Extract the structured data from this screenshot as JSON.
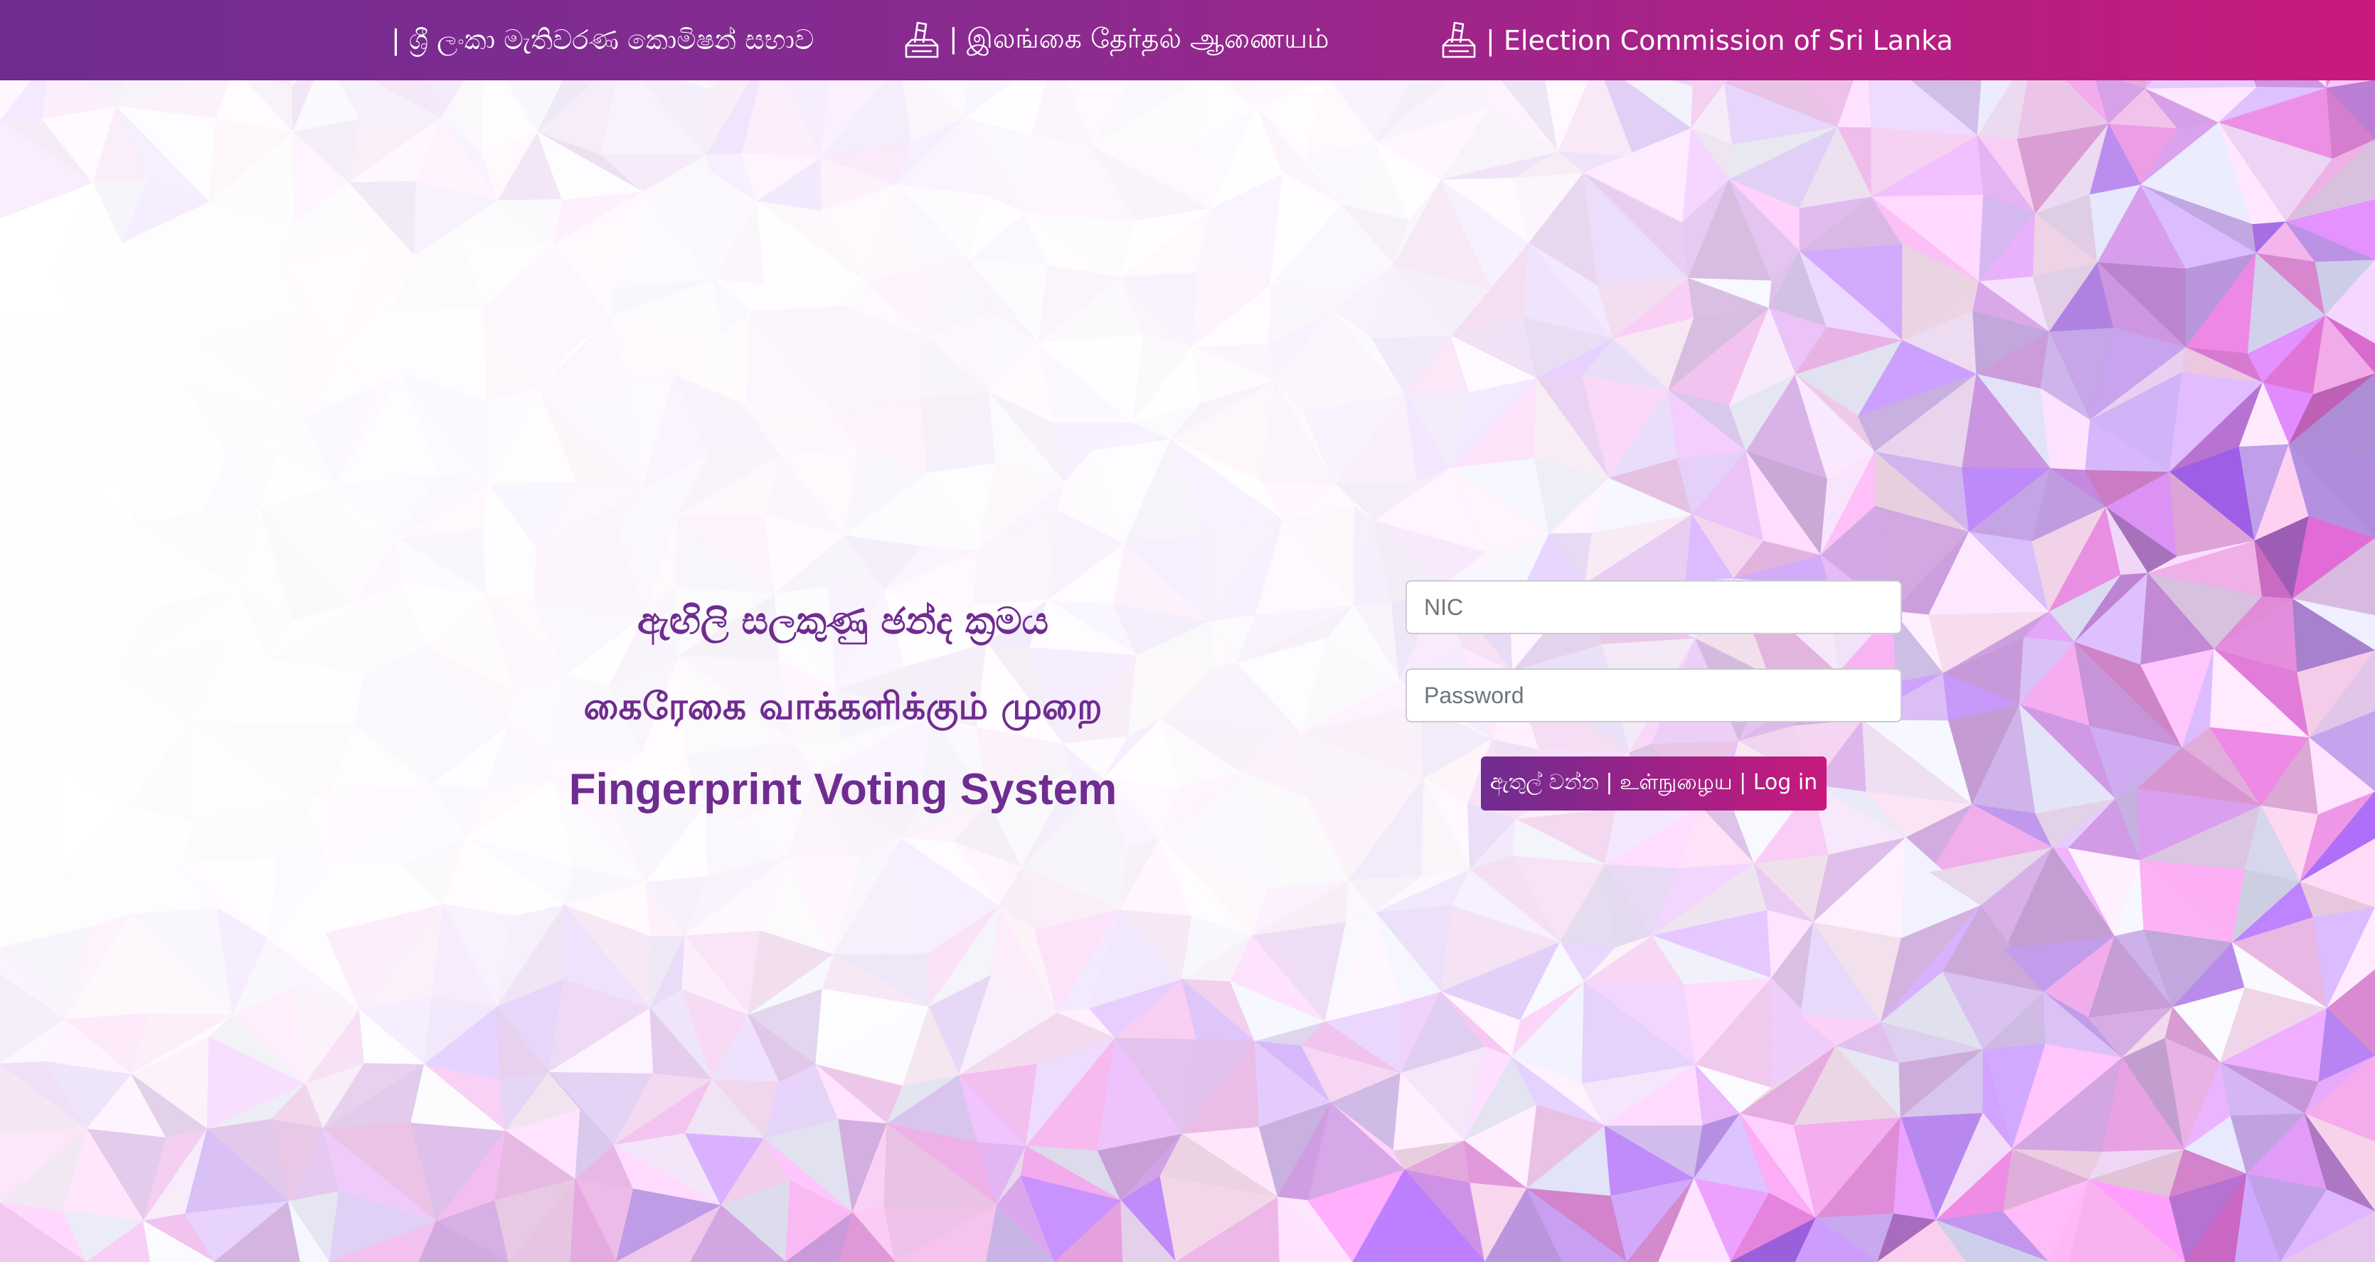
{
  "header": {
    "items": [
      {
        "label": "| ශ්‍රී ලංකා මැතිවරණ කොමිෂන් සභාව"
      },
      {
        "label": "| இலங்கை தேர்தல் ஆணையம்",
        "icon": "ballot-box-icon"
      },
      {
        "label": "| Election Commission of Sri Lanka",
        "icon": "ballot-box-icon"
      }
    ],
    "colors": {
      "start": "#6f2c91",
      "end": "#c8197d"
    }
  },
  "main": {
    "title_si": "ඇඟිලි සලකුණු ඡන්ද ක්‍රමය",
    "title_ta": "கைரேகை வாக்களிக்கும் முறை",
    "title_en": "Fingerprint Voting System"
  },
  "login": {
    "nic_placeholder": "NIC",
    "nic_value": "",
    "password_placeholder": "Password",
    "password_value": "",
    "button_label": "ඇතුල් වන්න | உள்நுழைய | Log in"
  },
  "theme": {
    "accent": "#6f2c91",
    "brand_pink": "#c8197d"
  }
}
